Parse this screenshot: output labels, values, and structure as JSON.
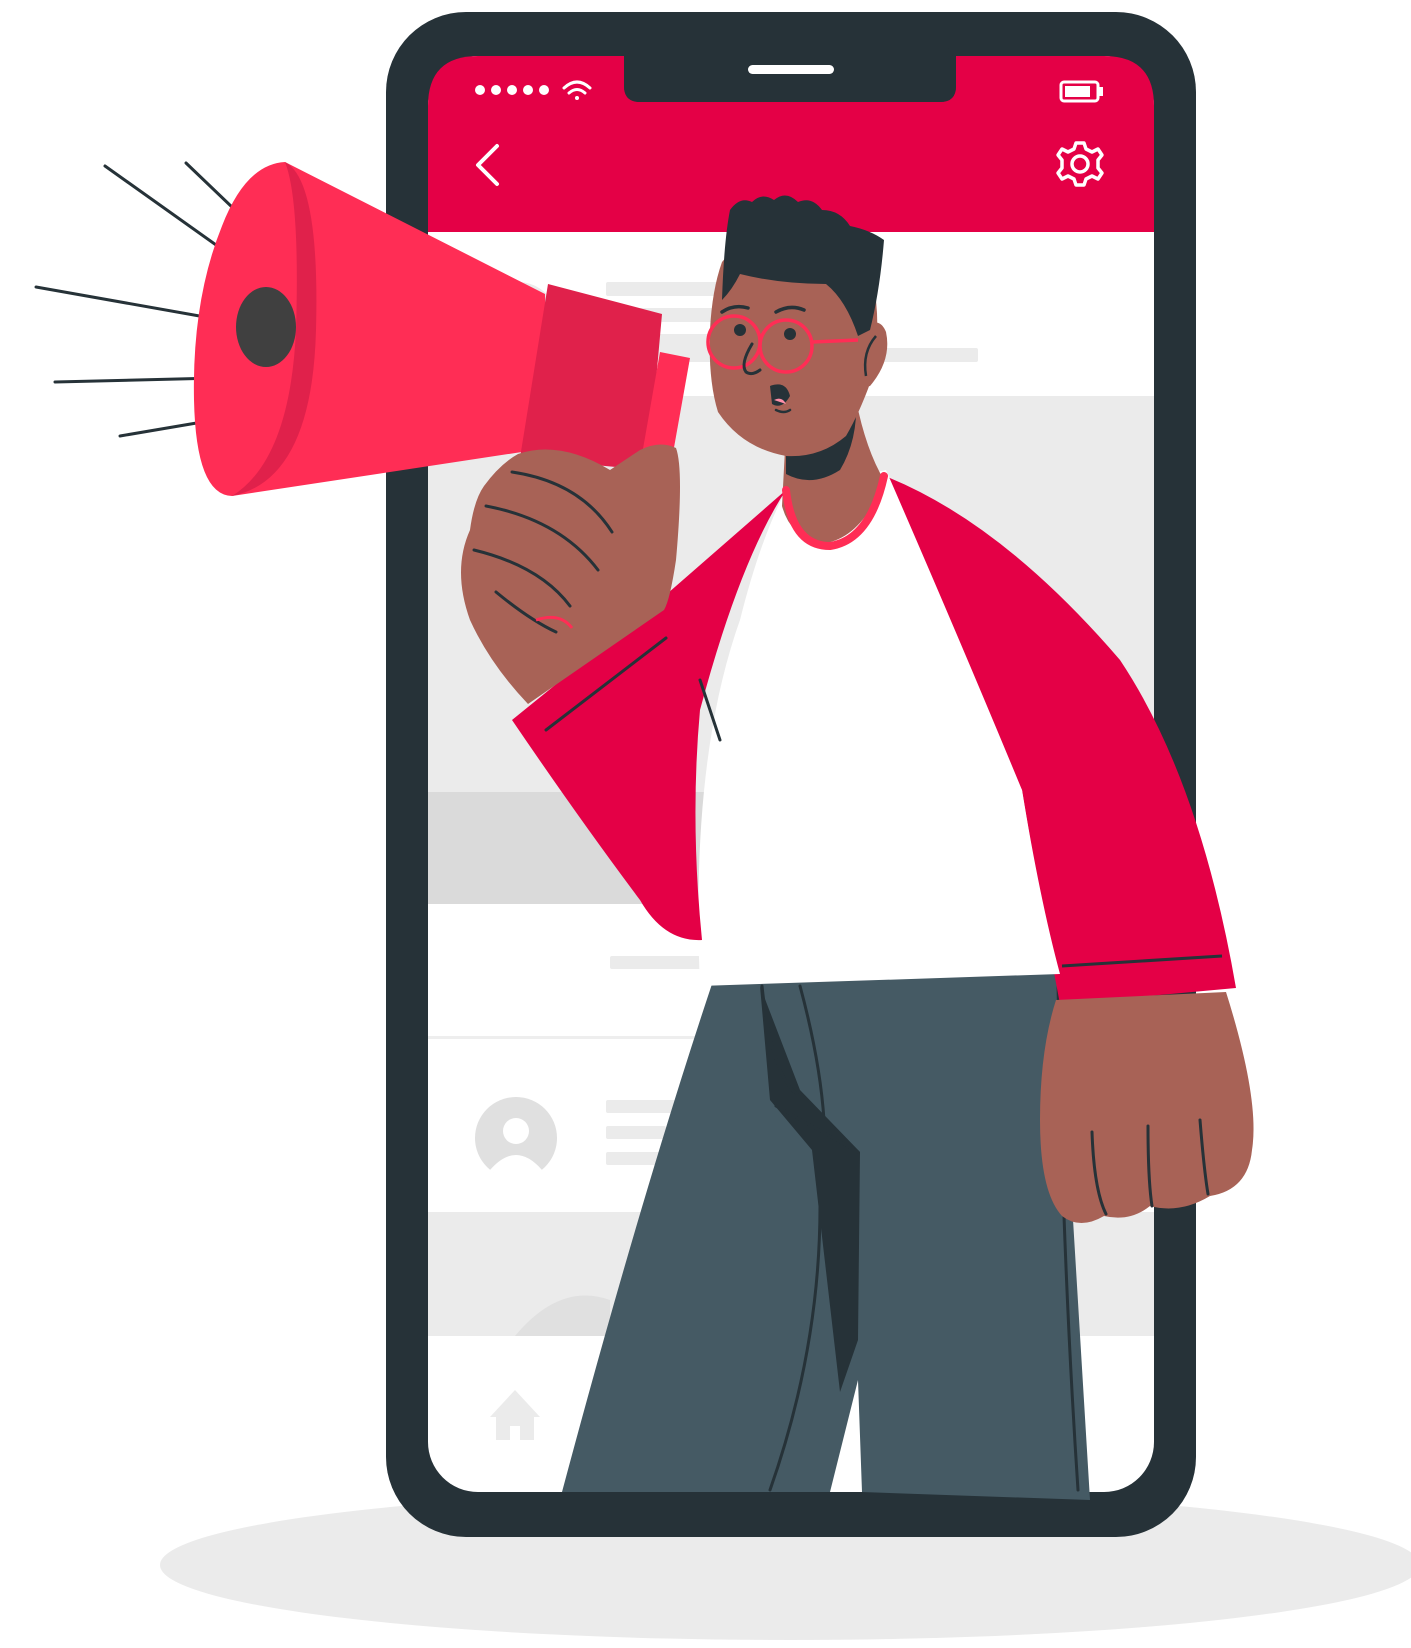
{
  "illustration": {
    "kind": "megaphone-announcement",
    "icons": [
      "signal-dots-icon",
      "wifi-icon",
      "battery-icon",
      "back-arrow-icon",
      "gear-icon",
      "home-icon",
      "avatar-icon"
    ],
    "colors": {
      "accent": "#E40046",
      "megaphone": "#FF2D55",
      "megaphone_dark": "#E0214B",
      "phone_frame": "#263238",
      "skin": "#A86256",
      "pants": "#455A64",
      "placeholder": "#EBEBEB",
      "shadow": "#EBEBEB"
    },
    "status_bar": {
      "signal_dots": 5,
      "battery_level": 0.75
    }
  }
}
